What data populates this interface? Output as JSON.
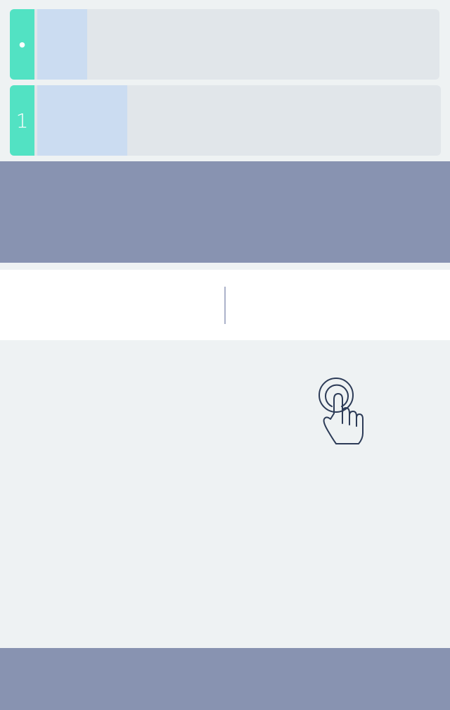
{
  "cards": [
    {
      "badge": "•",
      "fill_fraction": 0.12
    },
    {
      "badge": "1",
      "fill_fraction": 0.21
    }
  ],
  "icons": {
    "tap": "tap-gesture-icon"
  },
  "colors": {
    "background": "#eef2f3",
    "card": "#e1e6ea",
    "accent": "#52e2c3",
    "fill": "#cbdcf1",
    "banner": "#8893b1",
    "panel": "#ffffff",
    "divider": "#aab1c9",
    "icon_stroke": "#2c3b57"
  }
}
